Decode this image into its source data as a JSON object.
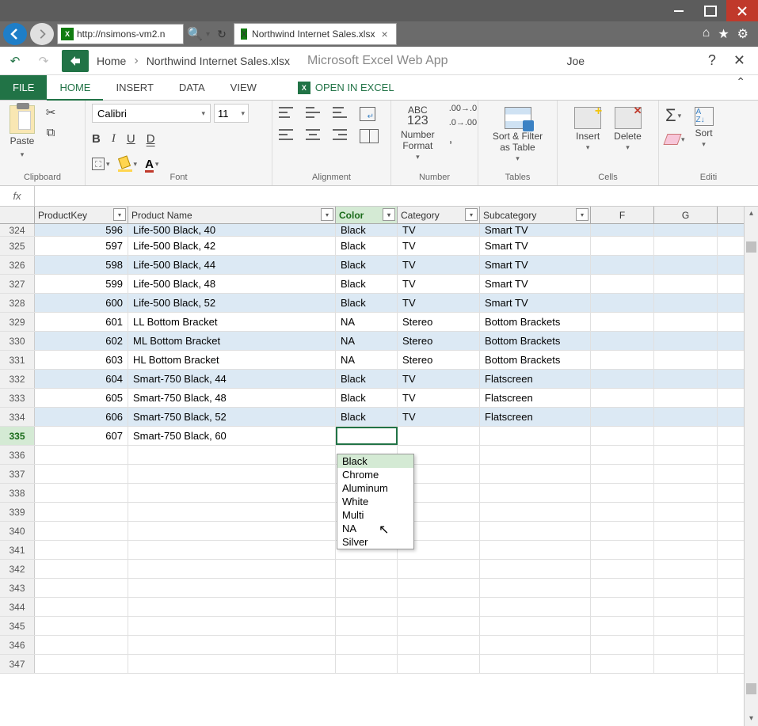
{
  "url": "http://nsimons-vm2.n",
  "tab_title": "Northwind Internet Sales.xlsx",
  "breadcrumb": {
    "home": "Home",
    "file": "Northwind Internet Sales.xlsx",
    "app": "Microsoft Excel Web App"
  },
  "user": "Joe",
  "ribbon_tabs": {
    "file": "FILE",
    "home": "HOME",
    "insert": "INSERT",
    "data": "DATA",
    "view": "VIEW",
    "open": "OPEN IN EXCEL"
  },
  "font": {
    "name": "Calibri",
    "size": "11"
  },
  "groups": {
    "clipboard": "Clipboard",
    "font": "Font",
    "alignment": "Alignment",
    "number": "Number",
    "tables": "Tables",
    "cells": "Cells",
    "editing": "Editi"
  },
  "labels": {
    "paste": "Paste",
    "numberformat": "Number Format",
    "sortfilter": "Sort & Filter as Table",
    "insert": "Insert",
    "delete": "Delete",
    "sort": "Sort",
    "abc": "ABC",
    "n123": "123"
  },
  "columns": {
    "A": "ProductKey",
    "B": "Product Name",
    "C": "Color",
    "D": "Category",
    "E": "Subcategory",
    "F": "F",
    "G": "G"
  },
  "row_start": 324,
  "rows": [
    {
      "k": "596",
      "n": "Life-500 Black, 40",
      "c": "Black",
      "cat": "TV",
      "s": "Smart TV",
      "alt": true,
      "clip": true
    },
    {
      "k": "597",
      "n": "Life-500 Black, 42",
      "c": "Black",
      "cat": "TV",
      "s": "Smart TV",
      "alt": false
    },
    {
      "k": "598",
      "n": "Life-500 Black, 44",
      "c": "Black",
      "cat": "TV",
      "s": "Smart TV",
      "alt": true
    },
    {
      "k": "599",
      "n": "Life-500 Black, 48",
      "c": "Black",
      "cat": "TV",
      "s": "Smart TV",
      "alt": false
    },
    {
      "k": "600",
      "n": "Life-500 Black, 52",
      "c": "Black",
      "cat": "TV",
      "s": "Smart TV",
      "alt": true
    },
    {
      "k": "601",
      "n": "LL Bottom Bracket",
      "c": "NA",
      "cat": "Stereo",
      "s": "Bottom Brackets",
      "alt": false
    },
    {
      "k": "602",
      "n": "ML Bottom Bracket",
      "c": "NA",
      "cat": "Stereo",
      "s": "Bottom Brackets",
      "alt": true
    },
    {
      "k": "603",
      "n": "HL Bottom Bracket",
      "c": "NA",
      "cat": "Stereo",
      "s": "Bottom Brackets",
      "alt": false
    },
    {
      "k": "604",
      "n": "Smart-750 Black, 44",
      "c": "Black",
      "cat": "TV",
      "s": "Flatscreen",
      "alt": true
    },
    {
      "k": "605",
      "n": "Smart-750 Black, 48",
      "c": "Black",
      "cat": "TV",
      "s": "Flatscreen",
      "alt": false
    },
    {
      "k": "606",
      "n": "Smart-750 Black, 52",
      "c": "Black",
      "cat": "TV",
      "s": "Flatscreen",
      "alt": true
    },
    {
      "k": "607",
      "n": "Smart-750 Black, 60",
      "c": "",
      "cat": "",
      "s": "",
      "alt": false,
      "editing": true
    }
  ],
  "empty_rows": [
    336,
    337,
    338,
    339,
    340,
    341,
    342,
    343,
    344,
    345,
    346,
    347
  ],
  "dropdown": [
    "Black",
    "Chrome",
    "Aluminum",
    "White",
    "Multi",
    "NA",
    "Silver"
  ],
  "fx_label": "fx"
}
